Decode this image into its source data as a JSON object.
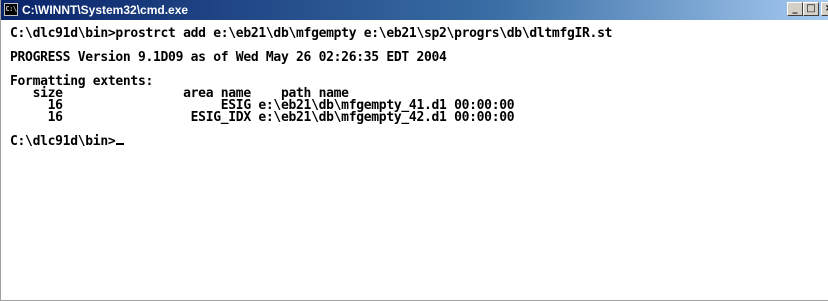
{
  "window": {
    "title": "C:\\WINNT\\System32\\cmd.exe",
    "icon_label": "C:\\",
    "controls": {
      "minimize": "_",
      "maximize": "□",
      "close": "×"
    }
  },
  "console": {
    "lines": [
      "C:\\dlc91d\\bin>prostrct add e:\\eb21\\db\\mfgempty e:\\eb21\\sp2\\progrs\\db\\dltmfgIR.st",
      "",
      "PROGRESS Version 9.1D09 as of Wed May 26 02:26:35 EDT 2004",
      "",
      "Formatting extents:",
      "   size                area name    path name",
      "     16                     ESIG e:\\eb21\\db\\mfgempty_41.d1 00:00:00",
      "     16                 ESIG_IDX e:\\eb21\\db\\mfgempty_42.d1 00:00:00",
      "",
      "C:\\dlc91d\\bin>"
    ]
  }
}
